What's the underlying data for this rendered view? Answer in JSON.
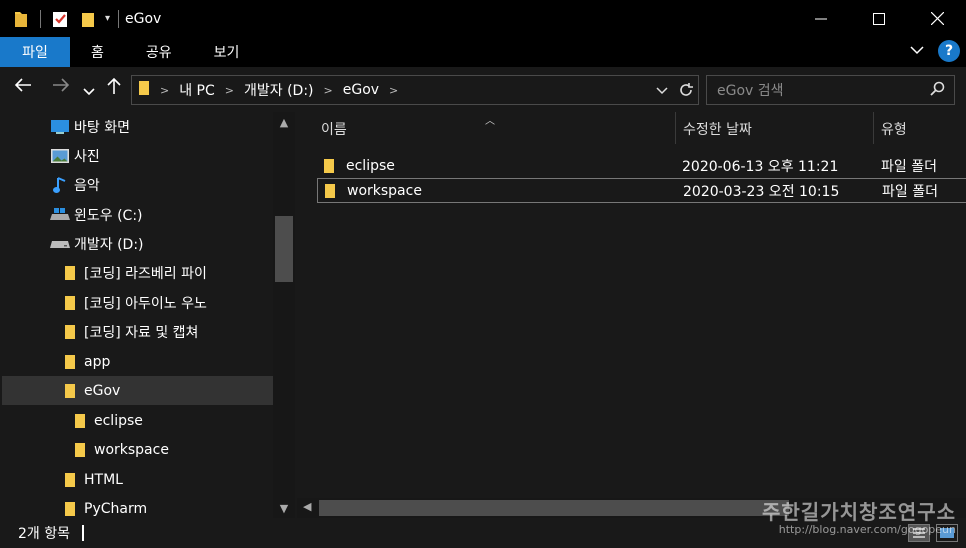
{
  "window": {
    "title": "eGov"
  },
  "ribbon": {
    "tabs": [
      "파일",
      "홈",
      "공유",
      "보기"
    ]
  },
  "address": {
    "crumbs": [
      "내 PC",
      "개발자 (D:)",
      "eGov"
    ]
  },
  "search": {
    "placeholder": "eGov 검색"
  },
  "nav": {
    "items": [
      {
        "label": "바탕 화면",
        "icon": "desktop-icon"
      },
      {
        "label": "사진",
        "icon": "pictures-icon"
      },
      {
        "label": "음악",
        "icon": "music-icon"
      },
      {
        "label": "윈도우 (C:)",
        "icon": "drive-c-icon"
      },
      {
        "label": "개발자 (D:)",
        "icon": "drive-d-icon"
      },
      {
        "label": "[코딩] 라즈베리 파이",
        "icon": "folder-icon"
      },
      {
        "label": "[코딩] 아두이노 우노",
        "icon": "folder-icon"
      },
      {
        "label": "[코딩] 자료 및 캡쳐",
        "icon": "folder-icon"
      },
      {
        "label": "app",
        "icon": "folder-icon"
      },
      {
        "label": "eGov",
        "icon": "folder-icon"
      },
      {
        "label": "eclipse",
        "icon": "folder-icon"
      },
      {
        "label": "workspace",
        "icon": "folder-icon"
      },
      {
        "label": "HTML",
        "icon": "folder-icon"
      },
      {
        "label": "PyCharm",
        "icon": "folder-icon"
      }
    ]
  },
  "files": {
    "columns": [
      "이름",
      "수정한 날짜",
      "유형"
    ],
    "rows": [
      {
        "name": "eclipse",
        "date": "2020-06-13 오후 11:21",
        "type": "파일 폴더"
      },
      {
        "name": "workspace",
        "date": "2020-03-23 오전 10:15",
        "type": "파일 폴더"
      }
    ]
  },
  "status": {
    "count": "2개 항목"
  },
  "watermark": {
    "title": "주한길가치창조연구소",
    "url": "http://blog.naver.com/gogopeun"
  },
  "colors": {
    "accent": "#1979ca",
    "folder": "#f5c94a",
    "bg": "#191919"
  }
}
